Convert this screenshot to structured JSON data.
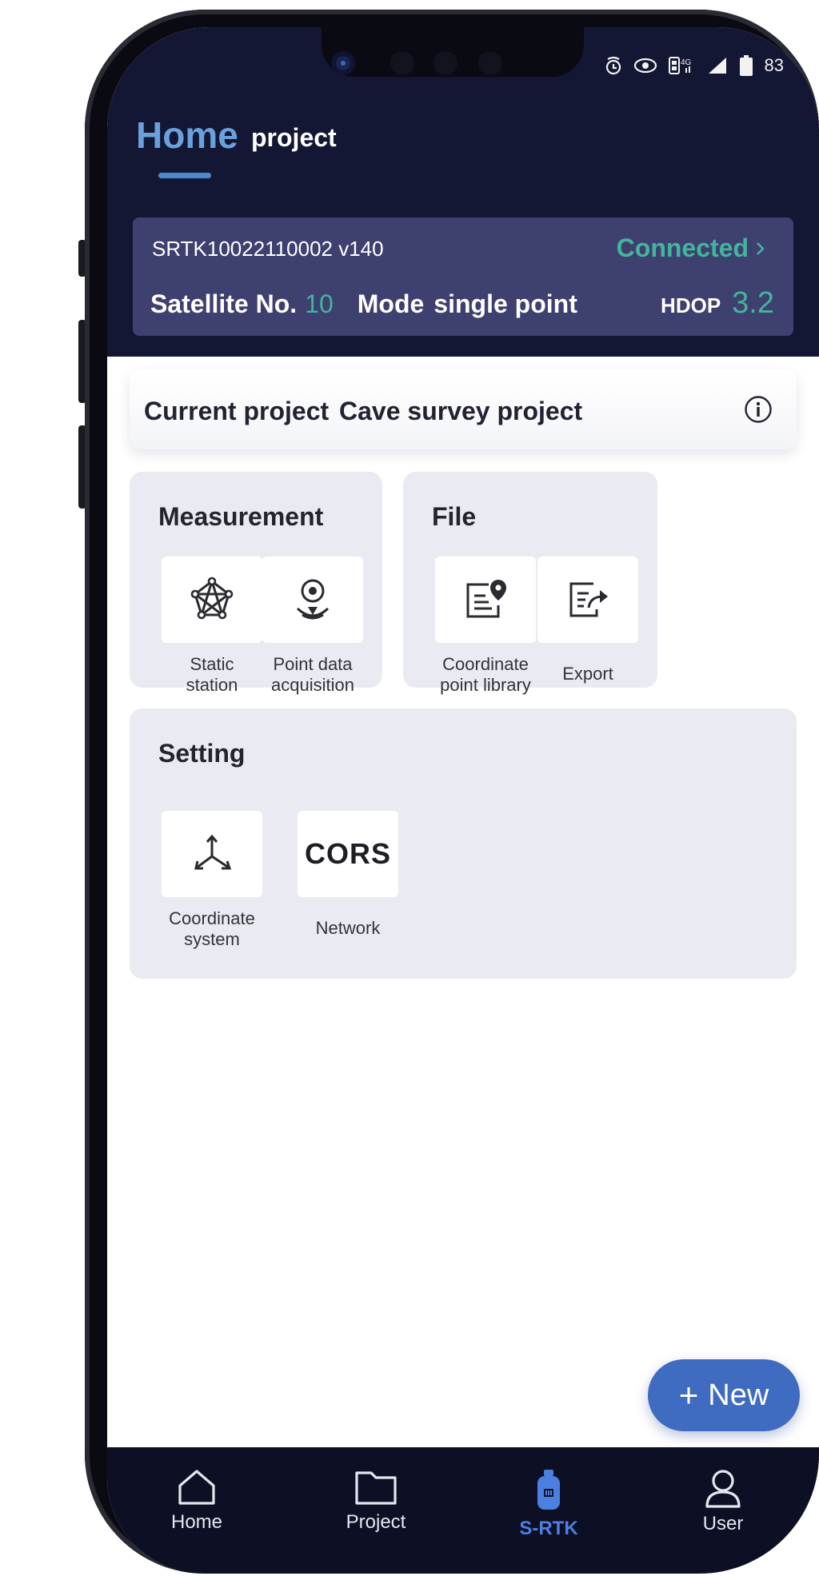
{
  "status_bar": {
    "battery": "83"
  },
  "header": {
    "tab_home": "Home",
    "tab_project": "project"
  },
  "device": {
    "id": "SRTK10022110002 v140",
    "status": "Connected",
    "satellite_label": "Satellite No.",
    "satellite_value": "10",
    "mode_label": "Mode",
    "mode_value": "single point",
    "hdop_label": "HDOP",
    "hdop_value": "3.2"
  },
  "current_project": {
    "label": "Current project",
    "name": "Cave survey project"
  },
  "measurement": {
    "title": "Measurement",
    "items": [
      {
        "label_line1": "Static",
        "label_line2": "station",
        "icon": "static-station-icon"
      },
      {
        "label_line1": "Point data",
        "label_line2": "acquisition",
        "icon": "location-point-icon"
      }
    ]
  },
  "file": {
    "title": "File",
    "items": [
      {
        "label_line1": "Coordinate",
        "label_line2": "point library",
        "icon": "coordinate-library-icon"
      },
      {
        "label_line1": "Export",
        "label_line2": "",
        "icon": "export-icon"
      }
    ]
  },
  "setting": {
    "title": "Setting",
    "items": [
      {
        "label_line1": "Coordinate",
        "label_line2": "system",
        "icon": "axes-icon"
      },
      {
        "label_line1": "Network",
        "label_line2": "",
        "tile_text": "CORS",
        "icon": "cors-icon"
      }
    ]
  },
  "new_button": {
    "plus": "+",
    "label": "New"
  },
  "bottom_nav": {
    "items": [
      {
        "label": "Home",
        "icon": "home-icon"
      },
      {
        "label": "Project",
        "icon": "folder-icon"
      },
      {
        "label": "S-RTK",
        "icon": "srtk-device-icon"
      },
      {
        "label": "User",
        "icon": "user-icon"
      }
    ]
  },
  "colors": {
    "header_bg": "#141733",
    "device_card_bg": "#3e4070",
    "accent_green": "#43b59a",
    "accent_blue": "#4d7fe0",
    "card_bg": "#eaebf2"
  }
}
